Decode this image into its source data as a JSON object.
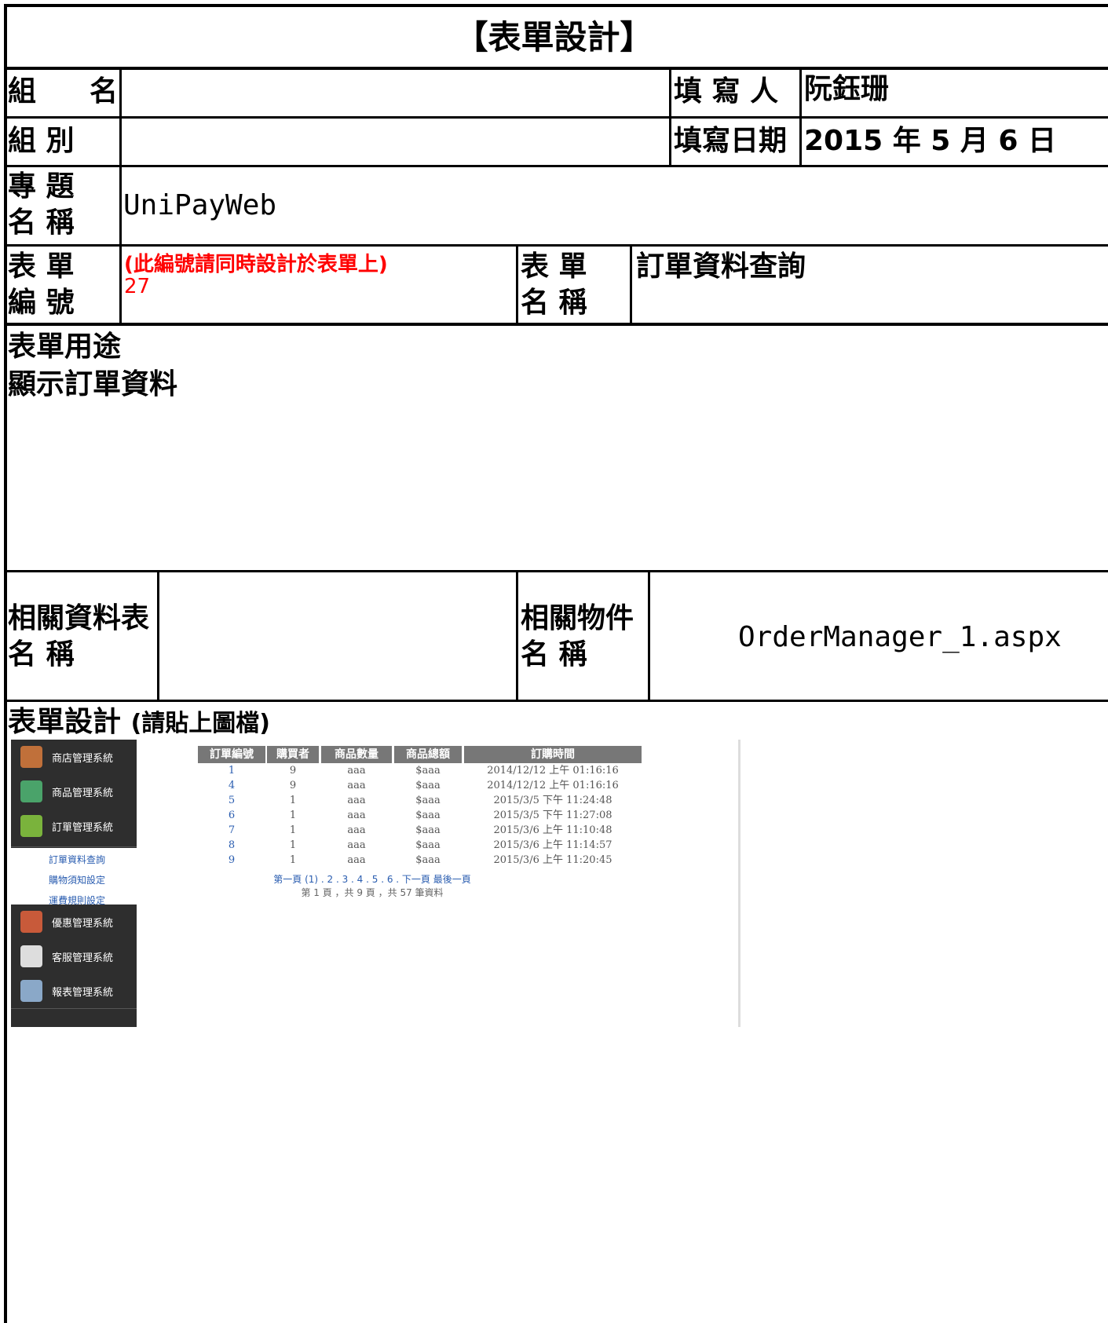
{
  "title": "【表單設計】",
  "rows": {
    "group_name_label": "組 名",
    "group_name_value": "",
    "filler_label": "填 寫 人",
    "filler_value": "阮鈺珊",
    "group_label": "組 別",
    "group_value": "",
    "fill_date_label": "填寫日期",
    "fill_date_value": "2015 年 5 月 6 日",
    "project_label_1": "專 題",
    "project_label_2": "名 稱",
    "project_value": "UniPayWeb",
    "form_no_label_1": "表 單",
    "form_no_label_2": "編 號",
    "form_no_note": "(此編號請同時設計於表單上)",
    "form_no_value": "27",
    "form_name_label_1": "表 單",
    "form_name_label_2": "名 稱",
    "form_name_value": "訂單資料查詢",
    "purpose_label": "表單用途",
    "purpose_value": "顯示訂單資料",
    "related_table_label_1": "相關資料表",
    "related_table_label_2": "名 稱",
    "related_table_value": "",
    "related_object_label_1": "相關物件",
    "related_object_label_2": "名 稱",
    "related_object_value": "OrderManager_1.aspx",
    "design_label": "表單設計",
    "design_note": "(請貼上圖檔)"
  },
  "screenshot": {
    "nav_top": [
      {
        "label": "商店管理系統",
        "icon": "shop-icon",
        "color": "#c0703a"
      },
      {
        "label": "商品管理系統",
        "icon": "bag-icon",
        "color": "#4aa36a"
      },
      {
        "label": "訂單管理系統",
        "icon": "basket-icon",
        "color": "#7ab33c"
      }
    ],
    "sub_links": [
      "訂單資料查詢",
      "購物須知設定",
      "運費規則設定"
    ],
    "nav_bottom": [
      {
        "label": "優惠管理系統",
        "icon": "tag-icon",
        "color": "#c85a3a"
      },
      {
        "label": "客服管理系統",
        "icon": "note-icon",
        "color": "#dddddd"
      },
      {
        "label": "報表管理系統",
        "icon": "report-icon",
        "color": "#8aa8c8"
      }
    ],
    "table": {
      "headers": [
        "訂單編號",
        "購買者",
        "商品數量",
        "商品總額",
        "訂購時間"
      ],
      "rows": [
        [
          "1",
          "9",
          "aaa",
          "$aaa",
          "2014/12/12 上午 01:16:16"
        ],
        [
          "4",
          "9",
          "aaa",
          "$aaa",
          "2014/12/12 上午 01:16:16"
        ],
        [
          "5",
          "1",
          "aaa",
          "$aaa",
          "2015/3/5 下午 11:24:48"
        ],
        [
          "6",
          "1",
          "aaa",
          "$aaa",
          "2015/3/5 下午 11:27:08"
        ],
        [
          "7",
          "1",
          "aaa",
          "$aaa",
          "2015/3/6 上午 11:10:48"
        ],
        [
          "8",
          "1",
          "aaa",
          "$aaa",
          "2015/3/6 上午 11:14:57"
        ],
        [
          "9",
          "1",
          "aaa",
          "$aaa",
          "2015/3/6 上午 11:20:45"
        ]
      ]
    },
    "pager": "第一頁 (1) . 2 . 3 . 4 . 5 . 6 . 下一頁 最後一頁",
    "pager_summary": "第 1 頁 ，共 9 頁 ，共 57 筆資料"
  }
}
